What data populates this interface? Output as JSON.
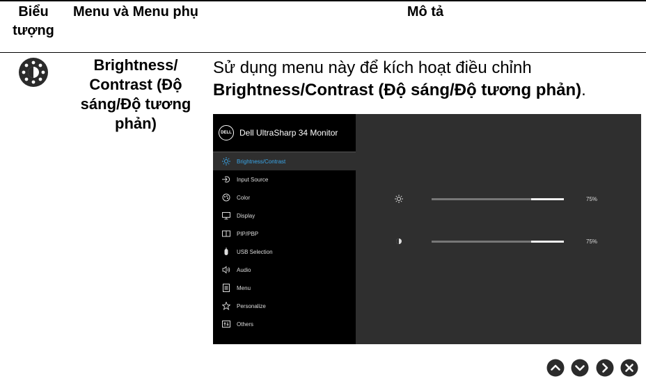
{
  "table": {
    "headers": {
      "icon": "Biểu tượng",
      "menu": "Menu và Menu phụ",
      "description": "Mô tả"
    }
  },
  "row": {
    "menu_name": "Brightness/ Contrast (Độ sáng/Độ tương phản)",
    "desc_plain": "Sử dụng menu này để kích hoạt điều chỉnh ",
    "desc_bold": "Brightness/Contrast (Độ sáng/Độ tương phản)",
    "desc_end": "."
  },
  "osd": {
    "title": "Dell UltraSharp 34 Monitor",
    "logo_text": "DELL",
    "menu_items": [
      {
        "label": "Brightness/Contrast",
        "icon": "brightness-icon",
        "active": true
      },
      {
        "label": "Input Source",
        "icon": "input-source-icon"
      },
      {
        "label": "Color",
        "icon": "color-icon"
      },
      {
        "label": "Display",
        "icon": "display-icon"
      },
      {
        "label": "PIP/PBP",
        "icon": "pip-pbp-icon"
      },
      {
        "label": "USB Selection",
        "icon": "usb-icon"
      },
      {
        "label": "Audio",
        "icon": "audio-icon"
      },
      {
        "label": "Menu",
        "icon": "menu-icon"
      },
      {
        "label": "Personalize",
        "icon": "star-icon"
      },
      {
        "label": "Others",
        "icon": "others-icon"
      }
    ],
    "brightness": {
      "value": 0.75,
      "label": "75%"
    },
    "contrast": {
      "value": 0.75,
      "label": "75%"
    },
    "colors": {
      "active": "#3aa6e8",
      "panel": "#2f2f2f",
      "sidebar": "#000000"
    }
  },
  "nav_buttons": [
    "up-icon",
    "down-icon",
    "right-icon",
    "close-icon"
  ]
}
